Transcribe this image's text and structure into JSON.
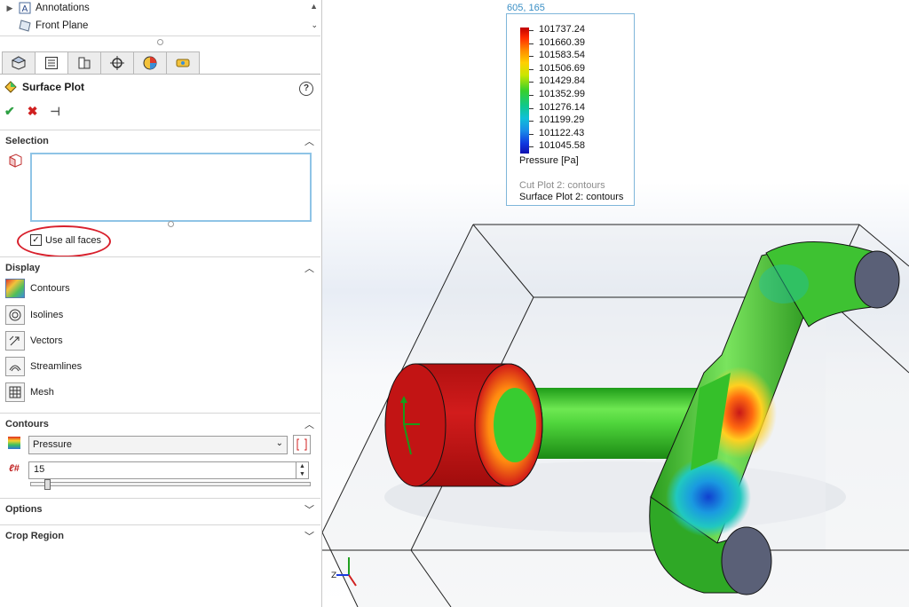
{
  "tree": {
    "items": [
      {
        "label": "Annotations"
      },
      {
        "label": "Front Plane"
      }
    ]
  },
  "tabs": [
    {
      "name": "tab-feature-manager"
    },
    {
      "name": "tab-property-manager"
    },
    {
      "name": "tab-configuration-manager"
    },
    {
      "name": "tab-dimxpert-manager"
    },
    {
      "name": "tab-display-manager"
    },
    {
      "name": "tab-flow-analysis"
    }
  ],
  "property_manager": {
    "title": "Surface Plot",
    "help": "?",
    "ok": "✔",
    "cancel": "✖",
    "pin": "⊣"
  },
  "selection": {
    "title": "Selection",
    "use_all_faces_label": "Use all faces",
    "use_all_faces_checked": "✓"
  },
  "display": {
    "title": "Display",
    "items": [
      {
        "label": "Contours"
      },
      {
        "label": "Isolines"
      },
      {
        "label": "Vectors"
      },
      {
        "label": "Streamlines"
      },
      {
        "label": "Mesh"
      }
    ]
  },
  "contours": {
    "title": "Contours",
    "parameter": "Pressure",
    "levels": "15",
    "levels_fraction": 0.05
  },
  "collapsed_groups": {
    "options": "Options",
    "crop_region": "Crop Region"
  },
  "viewport": {
    "coord_readout": "605, 165",
    "legend": {
      "values": [
        "101737.24",
        "101660.39",
        "101583.54",
        "101506.69",
        "101429.84",
        "101352.99",
        "101276.14",
        "101199.29",
        "101122.43",
        "101045.58"
      ],
      "unit": "Pressure [Pa]",
      "cut_plot": "Cut Plot 2: contours",
      "surface_plot": "Surface Plot 2: contours"
    }
  },
  "colors": {
    "accent": "#8fc4e6",
    "annotation_red": "#d8202c",
    "ok_green": "#2ea043",
    "cancel_red": "#d02020"
  }
}
